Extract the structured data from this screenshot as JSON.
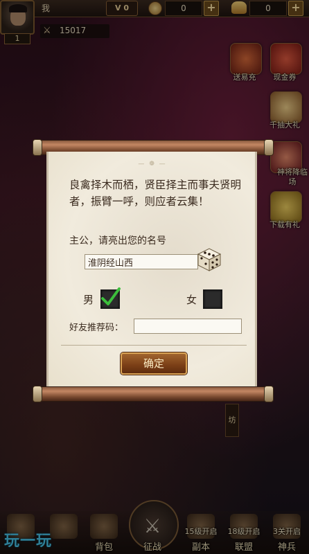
{
  "header": {
    "player_name": "我",
    "vip": "V 0",
    "coins": "0",
    "ingots": "0",
    "level": "1",
    "power": "15017"
  },
  "side_icons": [
    {
      "label": "送易充",
      "icon": "gift-icon",
      "color": "#b0442a"
    },
    {
      "label": "现金券",
      "icon": "voucher-icon",
      "color": "#c93a2a"
    },
    {
      "label": "千抽大礼",
      "icon": "scroll-icon",
      "color": "#d8b05a"
    },
    {
      "label": "神将降临场",
      "icon": "general-icon",
      "color": "#d65a4a"
    },
    {
      "label": "下载有礼",
      "icon": "download-icon",
      "color": "#e0c050"
    }
  ],
  "dialog": {
    "ornament": "— ❁ —",
    "intro": "良禽择木而栖，贤臣择主而事夫贤明者，振臂一呼，则应者云集！",
    "name_prompt": "主公，请亮出您的名号",
    "name_value": "淮阴经山西",
    "male_label": "男",
    "female_label": "女",
    "male_checked": true,
    "referral_label": "好友推荐码：",
    "referral_value": "",
    "confirm_label": "确定"
  },
  "shop_sign": "坊",
  "bottom_nav": [
    {
      "label": "",
      "lock": "",
      "icon": "palace-icon"
    },
    {
      "label": "",
      "lock": "",
      "icon": "general-icon"
    },
    {
      "label": "背包",
      "lock": "",
      "icon": "bag-icon"
    },
    {
      "label": "征战",
      "lock": "",
      "icon": "crossed-swords-icon"
    },
    {
      "label": "副本",
      "lock": "15级开启",
      "icon": "dungeon-icon"
    },
    {
      "label": "联盟",
      "lock": "18级开启",
      "icon": "alliance-icon"
    },
    {
      "label": "神兵",
      "lock": "3关开启",
      "icon": "weapon-icon"
    }
  ],
  "watermark": "玩一玩"
}
